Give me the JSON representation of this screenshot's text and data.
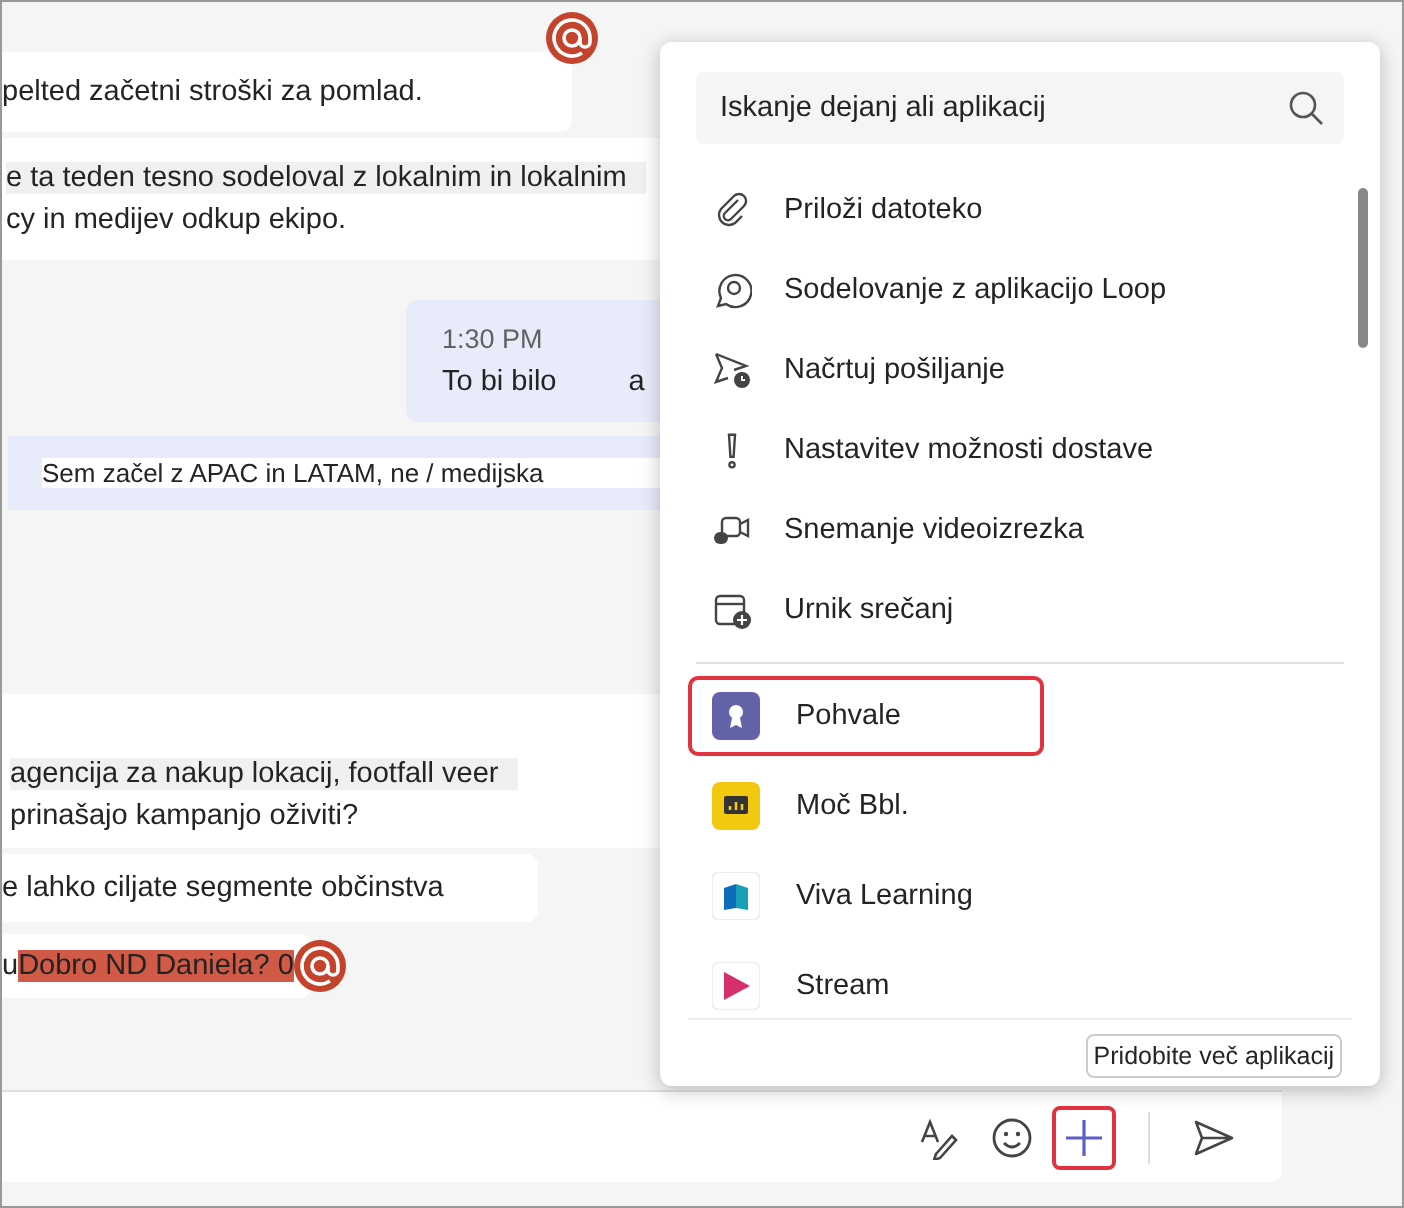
{
  "chat": {
    "messages": [
      {
        "kind": "bubble",
        "lines": [
          "pelted začetni stroški za pomlad."
        ],
        "mention": true
      },
      {
        "kind": "band",
        "lines": [
          "e ta teden tesno sodeloval z lokalnim in lokalnim",
          "cy in medijev odkup ekipo."
        ],
        "mention": false
      },
      {
        "kind": "own",
        "time": "1:30 PM",
        "lines": [
          "To bi bilo",
          "a"
        ],
        "mention": false
      },
      {
        "kind": "quote",
        "lines": [
          "Sem začel z APAC in LATAM, ne / medijska"
        ],
        "mention": false
      },
      {
        "kind": "band",
        "lines": [
          "agencija za nakup lokacij, footfall veer",
          "prinašajo kampanjo oživiti?"
        ],
        "mention": false
      },
      {
        "kind": "bubble",
        "lines": [
          "e lahko ciljate segmente občinstva"
        ],
        "mention": false
      },
      {
        "kind": "bubble",
        "lines": [
          "u"
        ],
        "highlight": "Dobro ND Daniela? 0",
        "mention": true
      }
    ]
  },
  "menu": {
    "search": {
      "placeholder": "Iskanje dejanj ali aplikacij"
    },
    "actions": [
      {
        "kind": "attach",
        "label": "Priloži datoteko"
      },
      {
        "kind": "loop",
        "label": "Sodelovanje z aplikacijo Loop"
      },
      {
        "kind": "schedule",
        "label": "Načrtuj pošiljanje"
      },
      {
        "kind": "priority",
        "label": "Nastavitev možnosti dostave"
      },
      {
        "kind": "video",
        "label": "Snemanje videoizrezka"
      },
      {
        "kind": "meeting",
        "label": "Urnik srečanj"
      }
    ],
    "apps": [
      {
        "kind": "praise",
        "label": "Pohvale",
        "highlighted": true
      },
      {
        "kind": "power",
        "label": "Moč Bbl.",
        "highlighted": false
      },
      {
        "kind": "viva",
        "label": "Viva Learning",
        "highlighted": false
      },
      {
        "kind": "stream",
        "label": "Stream",
        "highlighted": false
      }
    ],
    "more_button": "Pridobite več aplikacij"
  },
  "compose": {
    "tools": [
      {
        "kind": "format",
        "highlighted": false
      },
      {
        "kind": "emoji",
        "highlighted": false
      },
      {
        "kind": "plus",
        "highlighted": true
      }
    ]
  }
}
